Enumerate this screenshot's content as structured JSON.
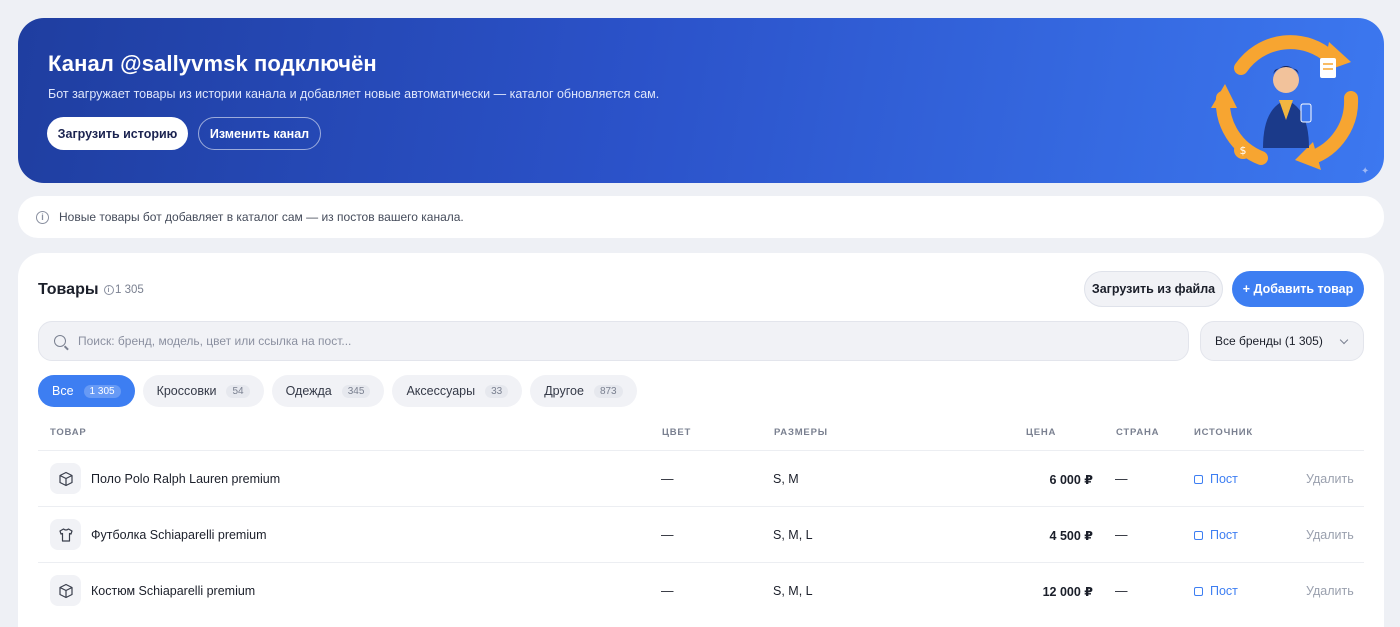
{
  "banner": {
    "title": "Канал @sallyvmsk подключён",
    "subtitle": "Бот загружает товары из истории канала и добавляет новые автоматически — каталог обновляется сам.",
    "load_history": "Загрузить историю",
    "change_channel": "Изменить канал"
  },
  "info": {
    "text": "Новые товары бот добавляет в каталог сам — из постов вашего канала."
  },
  "products": {
    "title": "Товары",
    "count": "1 305",
    "upload_file": "Загрузить из файла",
    "add_product": "+ Добавить товар",
    "search_placeholder": "Поиск: бренд, модель, цвет или ссылка на пост...",
    "brand_filter": "Все бренды (1 305)",
    "chips": [
      {
        "label": "Все",
        "count": "1 305"
      },
      {
        "label": "Кроссовки",
        "count": "54"
      },
      {
        "label": "Одежда",
        "count": "345"
      },
      {
        "label": "Аксессуары",
        "count": "33"
      },
      {
        "label": "Другое",
        "count": "873"
      }
    ],
    "columns": {
      "product": "ТОВАР",
      "color": "ЦВЕТ",
      "sizes": "РАЗМЕРЫ",
      "price": "ЦЕНА",
      "country": "СТРАНА",
      "source": "ИСТОЧНИК"
    },
    "rows": [
      {
        "name": "Поло Polo Ralph Lauren premium",
        "icon": "box-icon",
        "color": "—",
        "sizes": "S, M",
        "price": "6 000 ₽",
        "country": "—",
        "source": "Пост",
        "delete": "Удалить"
      },
      {
        "name": "Футболка Schiaparelli premium",
        "icon": "tshirt-icon",
        "color": "—",
        "sizes": "S, M, L",
        "price": "4 500 ₽",
        "country": "—",
        "source": "Пост",
        "delete": "Удалить"
      },
      {
        "name": "Костюм Schiaparelli premium",
        "icon": "box-icon",
        "color": "—",
        "sizes": "S, M, L",
        "price": "12 000 ₽",
        "country": "—",
        "source": "Пост",
        "delete": "Удалить"
      }
    ]
  },
  "colors": {
    "accent": "#3d7ef2",
    "banner_start": "#1f3ea0",
    "banner_end": "#3c78f0"
  }
}
